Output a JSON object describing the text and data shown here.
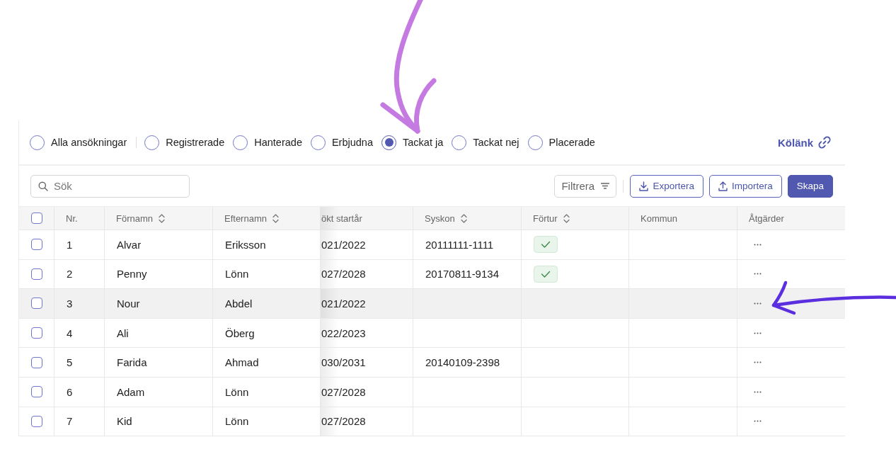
{
  "annotations": [
    {
      "kind": "down",
      "color": "#c47ae0"
    },
    {
      "kind": "left",
      "color": "#5b2ee0"
    }
  ],
  "status_filters": [
    {
      "label": "Alla ansökningar",
      "selected": false
    },
    {
      "label": "Registrerade",
      "selected": false
    },
    {
      "label": "Hanterade",
      "selected": false
    },
    {
      "label": "Erbjudna",
      "selected": false
    },
    {
      "label": "Tackat ja",
      "selected": true
    },
    {
      "label": "Tackat nej",
      "selected": false
    },
    {
      "label": "Placerade",
      "selected": false
    }
  ],
  "queue_link": {
    "label": "Kölänk"
  },
  "toolbar": {
    "search": {
      "placeholder": "Sök"
    },
    "filter": {
      "label": "Filtrera"
    },
    "buttons": [
      {
        "label": "Exportera",
        "kind": "export"
      },
      {
        "label": "Importera",
        "kind": "import"
      },
      {
        "label": "Skapa",
        "kind": "primary"
      }
    ]
  },
  "table": {
    "select_all": {
      "checked": false
    },
    "columns": [
      {
        "label": "Nr.",
        "sortable": false
      },
      {
        "label": "Förnamn",
        "sortable": true
      },
      {
        "label": "Efternamn",
        "sortable": true
      },
      {
        "label": "ökt startår",
        "sortable": false
      },
      {
        "label": "Syskon",
        "sortable": true
      },
      {
        "label": "Förtur",
        "sortable": true
      },
      {
        "label": "Kommun",
        "sortable": false
      },
      {
        "label": "Åtgärder",
        "sortable": false
      }
    ],
    "rows": [
      {
        "checked": false,
        "highlighted": false,
        "nr": "1",
        "first_name": "Alvar",
        "last_name": "Eriksson",
        "start_year": "021/2022",
        "sibling": "20111111-1111",
        "priority": true
      },
      {
        "checked": false,
        "highlighted": false,
        "nr": "2",
        "first_name": "Penny",
        "last_name": "Lönn",
        "start_year": "027/2028",
        "sibling": "20170811-9134",
        "priority": true
      },
      {
        "checked": false,
        "highlighted": true,
        "nr": "3",
        "first_name": "Nour",
        "last_name": "Abdel",
        "start_year": "021/2022",
        "priority": false
      },
      {
        "checked": false,
        "highlighted": false,
        "nr": "4",
        "first_name": "Ali",
        "last_name": "Öberg",
        "start_year": "022/2023",
        "priority": false
      },
      {
        "checked": false,
        "highlighted": false,
        "nr": "5",
        "first_name": "Farida",
        "last_name": "Ahmad",
        "start_year": "030/2031",
        "sibling": "20140109-2398",
        "priority": false
      },
      {
        "checked": false,
        "highlighted": false,
        "nr": "6",
        "first_name": "Adam",
        "last_name": "Lönn",
        "start_year": "027/2028",
        "priority": false
      },
      {
        "checked": false,
        "highlighted": false,
        "nr": "7",
        "first_name": "Kid",
        "last_name": "Lönn",
        "start_year": "027/2028",
        "priority": false
      }
    ]
  }
}
